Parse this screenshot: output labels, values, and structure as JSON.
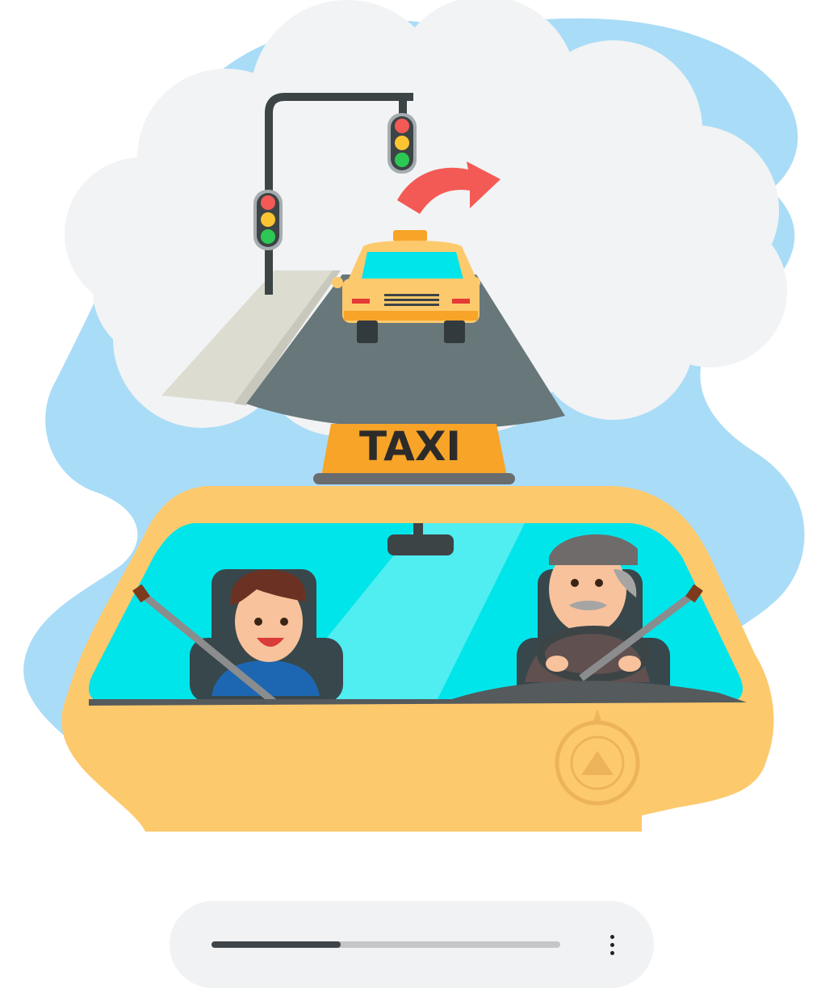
{
  "illustration": {
    "sign_text": "TAXI",
    "colors": {
      "sky_blob": "#a9dcf7",
      "cloud": "#f2f3f4",
      "taxi_yellow": "#fdc96d",
      "sign_orange": "#f7a428",
      "windshield": "#00e5ea",
      "road": "#67777a",
      "arrow": "#f45a55"
    },
    "icons": [
      "traffic-light-icon",
      "turn-right-arrow-icon",
      "taxi-icon",
      "university-seal-watermark"
    ]
  },
  "player": {
    "progress_fraction": 0.37,
    "menu_icon": "vertical-ellipsis-icon"
  }
}
